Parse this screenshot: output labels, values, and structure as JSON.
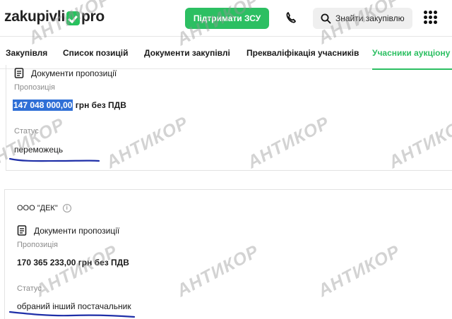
{
  "header": {
    "logo_left": "zakupivli",
    "logo_right": "pro",
    "support_button": "Підтримати ЗСУ",
    "search_button": "Знайти закупівлю"
  },
  "tabs": [
    {
      "label": "Закупівля",
      "active": false
    },
    {
      "label": "Список позицій",
      "active": false
    },
    {
      "label": "Документи закупівлі",
      "active": false
    },
    {
      "label": "Прекваліфікація учасників",
      "active": false
    },
    {
      "label": "Учасники аукціону",
      "active": true
    }
  ],
  "bids": [
    {
      "company": "",
      "documents_label": "Документи пропозиції",
      "offer_label": "Пропозиція",
      "amount": "147 048 000,00",
      "amount_suffix": " грн без ПДВ",
      "status_label": "Статус",
      "status": "переможець"
    },
    {
      "company": "ООО \"ДЕК\"",
      "documents_label": "Документи пропозиції",
      "offer_label": "Пропозиція",
      "amount": "170 365 233,00",
      "amount_suffix": " грн без ПДВ",
      "status_label": "Статус",
      "status": "обраний інший постачальник"
    }
  ],
  "watermark": "АНТИКОР",
  "colors": {
    "accent": "#2cbf62",
    "highlight": "#2f6fd6",
    "scribble": "#1f2fa8"
  }
}
